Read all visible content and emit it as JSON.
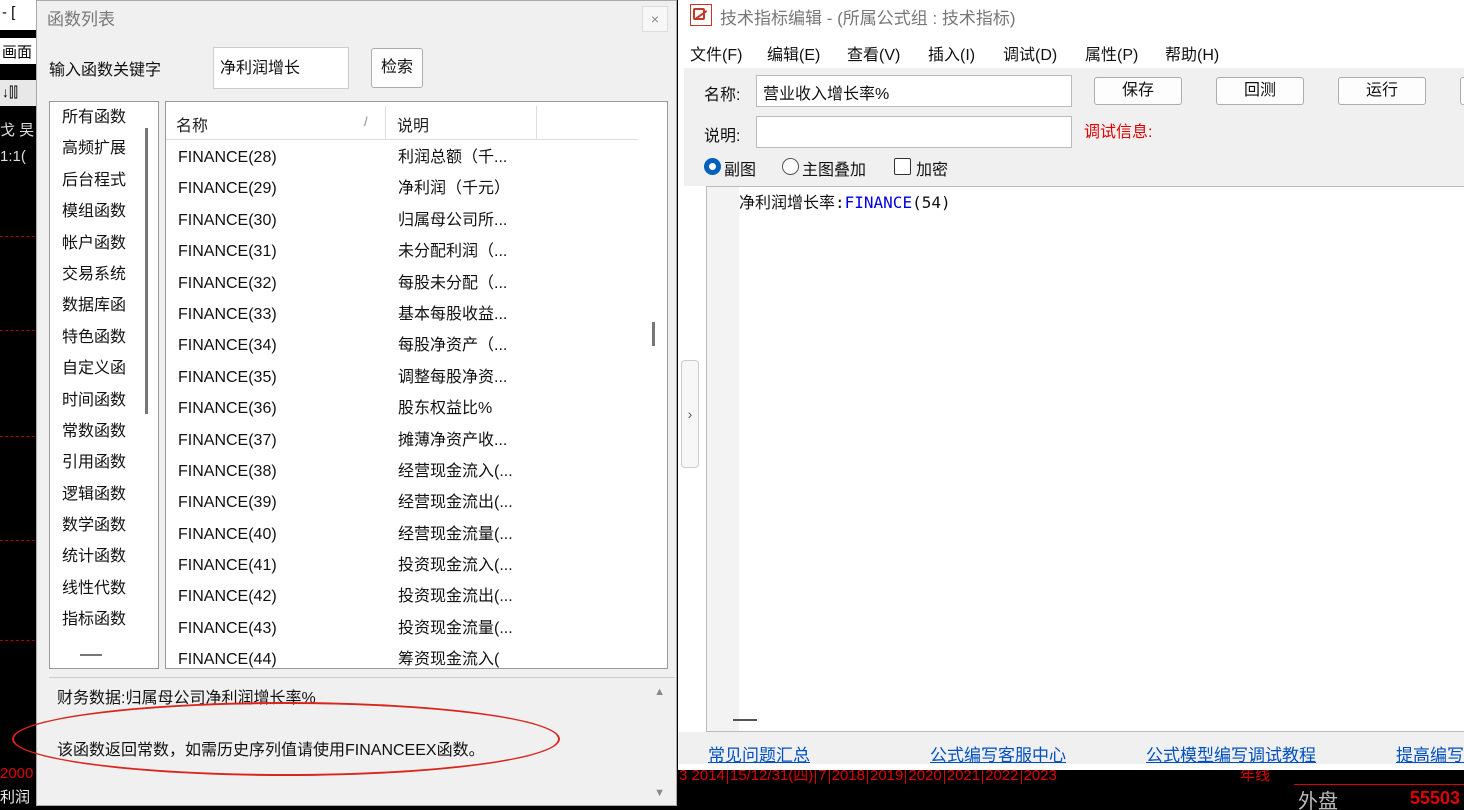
{
  "background": {
    "top_text": "- [",
    "menu_text": "画面",
    "tool_text": "↓⫿⫿",
    "dark_text": [
      "戈 旲",
      "1:1("
    ],
    "bottom_left": [
      "2000",
      "利润"
    ],
    "years": [
      "3 2014",
      "15/12/31(四)",
      "7",
      "2018",
      "2019",
      "2020",
      "2021",
      "2022",
      "2023"
    ],
    "year_label": "年线",
    "right_bottom_label": "外盘",
    "right_bottom_value": "55503"
  },
  "func_dialog": {
    "title": "函数列表",
    "close_label": "×",
    "keyword_label": "输入函数关键字",
    "keyword_value": "净利润增长",
    "search_label": "检索",
    "categories": [
      "所有函数",
      "高频扩展",
      "后台程式",
      "模组函数",
      "帐户函数",
      "交易系统",
      "数据库函",
      "特色函数",
      "自定义函",
      "时间函数",
      "常数函数",
      "引用函数",
      "逻辑函数",
      "数学函数",
      "统计函数",
      "线性代数",
      "指标函数"
    ],
    "col_name": "名称",
    "col_sort": "/",
    "col_desc": "说明",
    "rows": [
      {
        "name": "FINANCE(28)",
        "desc": "利润总额（千..."
      },
      {
        "name": "FINANCE(29)",
        "desc": "净利润（千元）"
      },
      {
        "name": "FINANCE(30)",
        "desc": "归属母公司所..."
      },
      {
        "name": "FINANCE(31)",
        "desc": "未分配利润（..."
      },
      {
        "name": "FINANCE(32)",
        "desc": "每股未分配（..."
      },
      {
        "name": "FINANCE(33)",
        "desc": "基本每股收益..."
      },
      {
        "name": "FINANCE(34)",
        "desc": "每股净资产（..."
      },
      {
        "name": "FINANCE(35)",
        "desc": "调整每股净资..."
      },
      {
        "name": "FINANCE(36)",
        "desc": "股东权益比%"
      },
      {
        "name": "FINANCE(37)",
        "desc": "摊薄净资产收..."
      },
      {
        "name": "FINANCE(38)",
        "desc": "经营现金流入(..."
      },
      {
        "name": "FINANCE(39)",
        "desc": "经营现金流出(..."
      },
      {
        "name": "FINANCE(40)",
        "desc": "经营现金流量(..."
      },
      {
        "name": "FINANCE(41)",
        "desc": "投资现金流入(..."
      },
      {
        "name": "FINANCE(42)",
        "desc": "投资现金流出(..."
      },
      {
        "name": "FINANCE(43)",
        "desc": "投资现金流量(..."
      },
      {
        "name": "FINANCE(44)",
        "desc": "筹资现金流入("
      }
    ],
    "desc_line1": "财务数据:归属母公司净利润增长率%",
    "desc_line2": "该函数返回常数，如需历史序列值请使用FINANCEEX函数。",
    "highlight_color": "#d9261c"
  },
  "editor": {
    "title": "技术指标编辑 - (所属公式组 : 技术指标)",
    "menu": [
      "文件(F)",
      "编辑(E)",
      "查看(V)",
      "插入(I)",
      "调试(D)",
      "属性(P)",
      "帮助(H)"
    ],
    "name_label": "名称:",
    "name_value": "营业收入增长率%",
    "desc_label": "说明:",
    "desc_value": "",
    "save_label": "保存",
    "backtest_label": "回测",
    "run_label": "运行",
    "debug_label": "调试信息:",
    "radio_sub": "副图",
    "radio_main": "主图叠加",
    "check_encrypt": "加密",
    "code_prefix": "净利润增长率:",
    "code_func": "FINANCE",
    "code_arg": "(54)",
    "links": [
      "常见问题汇总",
      "公式编写客服中心",
      "公式模型编写调试教程",
      "提高编写"
    ],
    "toggle_label": "›"
  }
}
